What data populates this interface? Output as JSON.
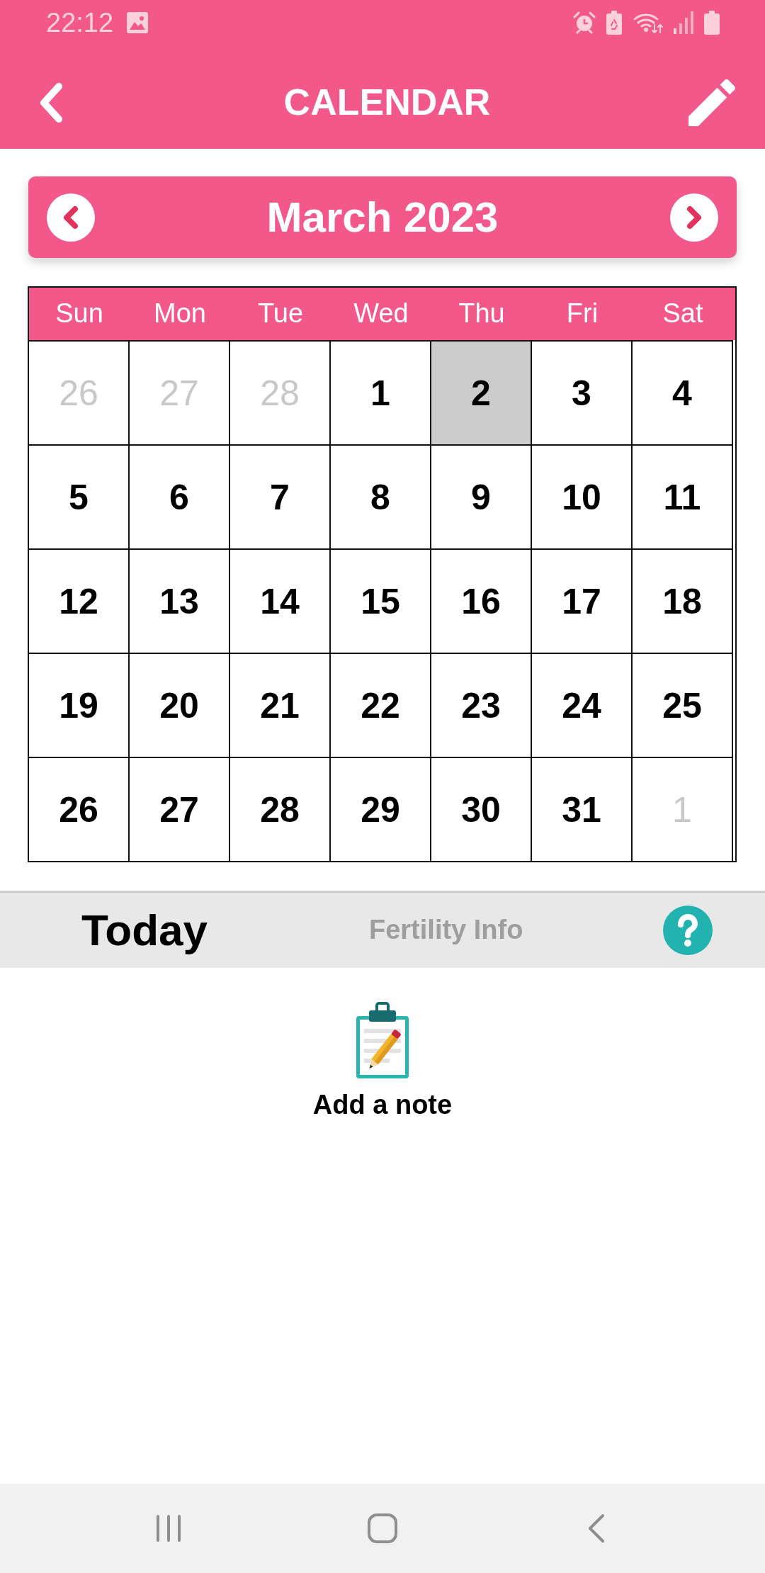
{
  "status_bar": {
    "time": "22:12"
  },
  "app_bar": {
    "title": "CALENDAR"
  },
  "month_header": {
    "title": "March 2023"
  },
  "calendar": {
    "weekdays": [
      "Sun",
      "Mon",
      "Tue",
      "Wed",
      "Thu",
      "Fri",
      "Sat"
    ],
    "weeks": [
      [
        {
          "day": "26",
          "in_month": false,
          "selected": false
        },
        {
          "day": "27",
          "in_month": false,
          "selected": false
        },
        {
          "day": "28",
          "in_month": false,
          "selected": false
        },
        {
          "day": "1",
          "in_month": true,
          "selected": false
        },
        {
          "day": "2",
          "in_month": true,
          "selected": true
        },
        {
          "day": "3",
          "in_month": true,
          "selected": false
        },
        {
          "day": "4",
          "in_month": true,
          "selected": false
        }
      ],
      [
        {
          "day": "5",
          "in_month": true,
          "selected": false
        },
        {
          "day": "6",
          "in_month": true,
          "selected": false
        },
        {
          "day": "7",
          "in_month": true,
          "selected": false
        },
        {
          "day": "8",
          "in_month": true,
          "selected": false
        },
        {
          "day": "9",
          "in_month": true,
          "selected": false
        },
        {
          "day": "10",
          "in_month": true,
          "selected": false
        },
        {
          "day": "11",
          "in_month": true,
          "selected": false
        }
      ],
      [
        {
          "day": "12",
          "in_month": true,
          "selected": false
        },
        {
          "day": "13",
          "in_month": true,
          "selected": false
        },
        {
          "day": "14",
          "in_month": true,
          "selected": false
        },
        {
          "day": "15",
          "in_month": true,
          "selected": false
        },
        {
          "day": "16",
          "in_month": true,
          "selected": false
        },
        {
          "day": "17",
          "in_month": true,
          "selected": false
        },
        {
          "day": "18",
          "in_month": true,
          "selected": false
        }
      ],
      [
        {
          "day": "19",
          "in_month": true,
          "selected": false
        },
        {
          "day": "20",
          "in_month": true,
          "selected": false
        },
        {
          "day": "21",
          "in_month": true,
          "selected": false
        },
        {
          "day": "22",
          "in_month": true,
          "selected": false
        },
        {
          "day": "23",
          "in_month": true,
          "selected": false
        },
        {
          "day": "24",
          "in_month": true,
          "selected": false
        },
        {
          "day": "25",
          "in_month": true,
          "selected": false
        }
      ],
      [
        {
          "day": "26",
          "in_month": true,
          "selected": false
        },
        {
          "day": "27",
          "in_month": true,
          "selected": false
        },
        {
          "day": "28",
          "in_month": true,
          "selected": false
        },
        {
          "day": "29",
          "in_month": true,
          "selected": false
        },
        {
          "day": "30",
          "in_month": true,
          "selected": false
        },
        {
          "day": "31",
          "in_month": true,
          "selected": false
        },
        {
          "day": "1",
          "in_month": false,
          "selected": false
        }
      ]
    ]
  },
  "tabs": [
    {
      "label": "Today",
      "selected": true
    },
    {
      "label": "Fertility Info",
      "selected": false
    }
  ],
  "note": {
    "label": "Add a note"
  }
}
